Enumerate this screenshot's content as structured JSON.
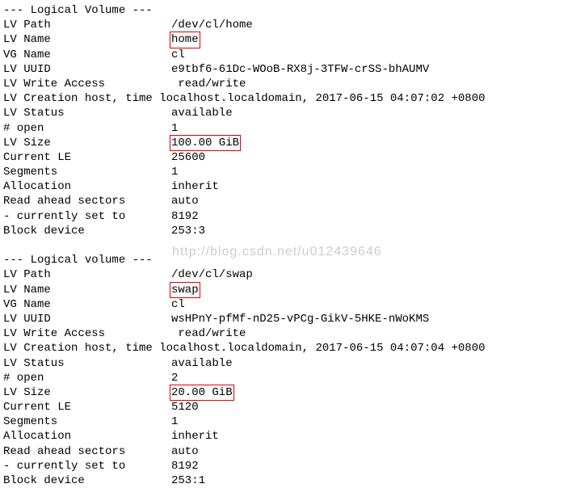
{
  "watermark": "http://blog.csdn.net/u012439646",
  "vol1": {
    "header": "--- Logical Volume ---",
    "path_label": "LV Path",
    "path_value": "/dev/cl/home",
    "name_label": "LV Name",
    "name_value": "home",
    "vg_label": "VG Name",
    "vg_value": "cl",
    "uuid_label": "LV UUID",
    "uuid_value": "e9tbf6-61Dc-WOoB-RX8j-3TFW-crSS-bhAUMV",
    "access_label": "LV Write Access",
    "access_value": " read/write",
    "creation_label": "LV Creation host, time",
    "creation_value": "localhost.localdomain, 2017-06-15 04:07:02 +0800",
    "status_label": "LV Status",
    "status_value": "available",
    "open_label": "# open",
    "open_value": "1",
    "size_label": "LV Size",
    "size_value": "100.00 GiB",
    "le_label": "Current LE",
    "le_value": "25600",
    "seg_label": "Segments",
    "seg_value": "1",
    "alloc_label": "Allocation",
    "alloc_value": "inherit",
    "ahead_label": "Read ahead sectors",
    "ahead_value": "auto",
    "setto_label": "- currently set to",
    "setto_value": "8192",
    "blkdev_label": "Block device",
    "blkdev_value": "253:3"
  },
  "vol2": {
    "header": "--- Logical volume ---",
    "path_label": "LV Path",
    "path_value": "/dev/cl/swap",
    "name_label": "LV Name",
    "name_value": "swap",
    "vg_label": "VG Name",
    "vg_value": "cl",
    "uuid_label": "LV UUID",
    "uuid_value": "wsHPnY-pfMf-nD25-vPCg-GikV-5HKE-nWoKMS",
    "access_label": "LV Write Access",
    "access_value": " read/write",
    "creation_label": "LV Creation host, time",
    "creation_value": "localhost.localdomain, 2017-06-15 04:07:04 +0800",
    "status_label": "LV Status",
    "status_value": "available",
    "open_label": "# open",
    "open_value": "2",
    "size_label": "LV Size",
    "size_value": "20.00 GiB",
    "le_label": "Current LE",
    "le_value": "5120",
    "seg_label": "Segments",
    "seg_value": "1",
    "alloc_label": "Allocation",
    "alloc_value": "inherit",
    "ahead_label": "Read ahead sectors",
    "ahead_value": "auto",
    "setto_label": "- currently set to",
    "setto_value": "8192",
    "blkdev_label": "Block device",
    "blkdev_value": "253:1"
  }
}
